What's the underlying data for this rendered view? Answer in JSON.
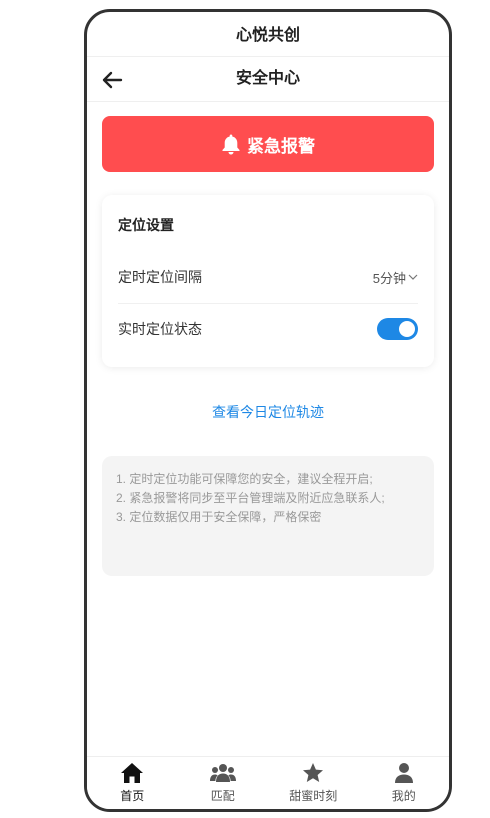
{
  "app": {
    "title": "心悦共创"
  },
  "nav": {
    "title": "安全中心"
  },
  "sos": {
    "label": "紧急报警"
  },
  "location_settings": {
    "title": "定位设置",
    "interval_label": "定时定位间隔",
    "interval_value": "5分钟",
    "realtime_label": "实时定位状态",
    "realtime_enabled": true
  },
  "track_link": "查看今日定位轨迹",
  "tips": [
    "1. 定时定位功能可保障您的安全，建议全程开启;",
    "2. 紧急报警将同步至平台管理端及附近应急联系人;",
    "3. 定位数据仅用于安全保障，严格保密"
  ],
  "tabbar": [
    {
      "label": "首页",
      "icon": "home-icon",
      "active": true
    },
    {
      "label": "匹配",
      "icon": "users-icon",
      "active": false
    },
    {
      "label": "甜蜜时刻",
      "icon": "star-icon",
      "active": false
    },
    {
      "label": "我的",
      "icon": "user-icon",
      "active": false
    }
  ],
  "colors": {
    "sos": "#ff4d4f",
    "accent": "#1e88e5"
  }
}
